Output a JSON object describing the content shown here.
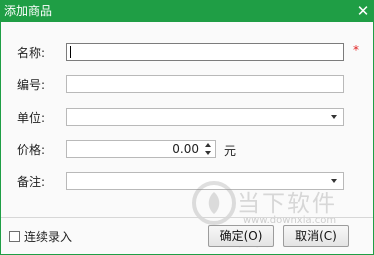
{
  "window": {
    "title": "添加商品",
    "close_symbol": "✕",
    "accent_color": "#1f9e45"
  },
  "form": {
    "name_label": "名称:",
    "name_value": "",
    "required_mark": "*",
    "code_label": "编号:",
    "code_value": "",
    "unit_label": "单位:",
    "unit_value": "",
    "price_label": "价格:",
    "price_value": "0.00",
    "price_unit": "元",
    "note_label": "备注:",
    "note_value": ""
  },
  "footer": {
    "continuous_entry_label": "连续录入",
    "continuous_entry_checked": false,
    "ok_label": "确定(O)",
    "cancel_label": "取消(C)"
  },
  "watermark": {
    "brand": "当下软件园",
    "url": "www.downxia.com"
  }
}
